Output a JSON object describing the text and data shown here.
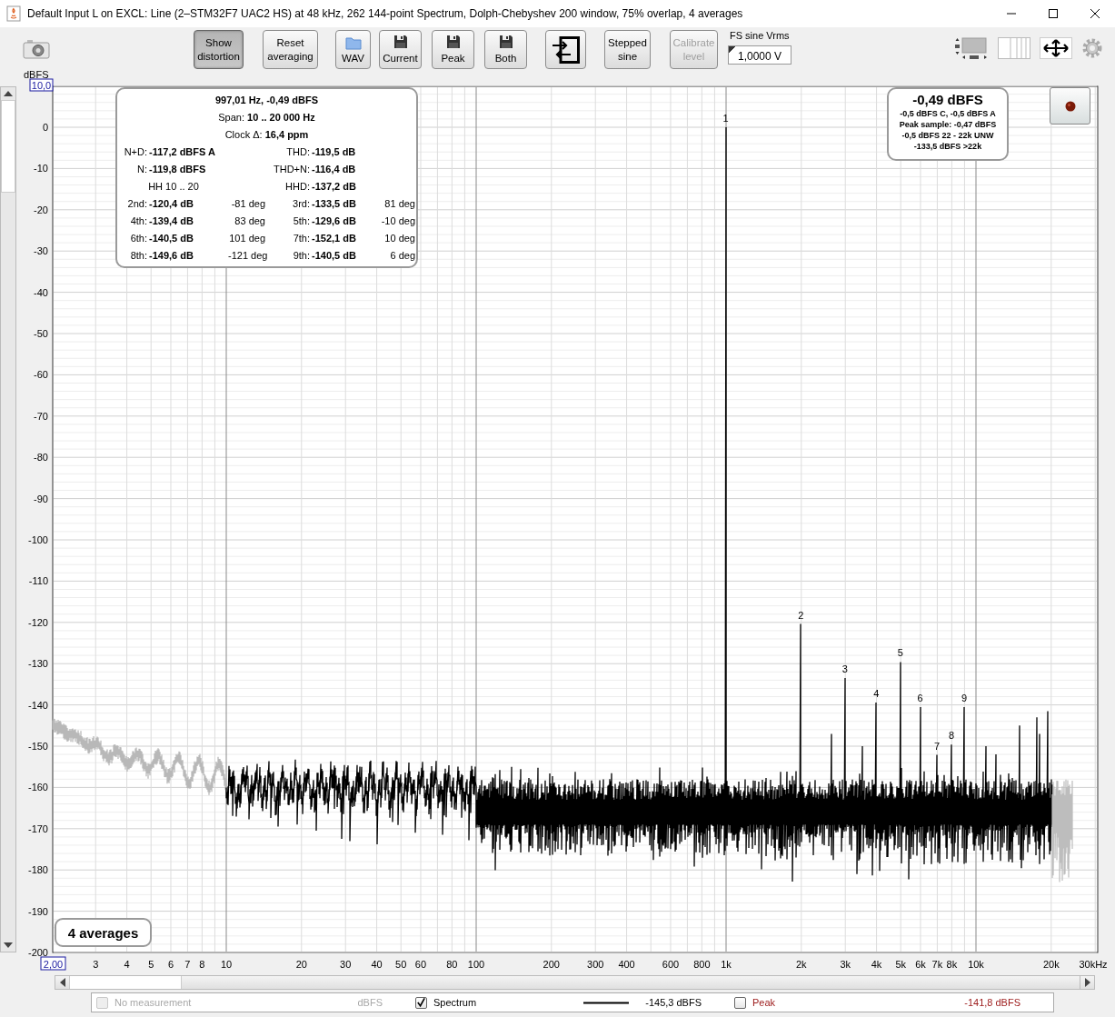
{
  "window": {
    "title": "Default Input L on EXCL: Line (2–STM32F7 UAC2 HS) at 48 kHz, 262 144-point Spectrum, Dolph-Chebyshev 200 window, 75% overlap, 4 averages"
  },
  "toolbar": {
    "buttons": [
      {
        "kind": "text",
        "label": "Show distortion",
        "selected": true,
        "disabled": false
      },
      {
        "kind": "text",
        "label": "Reset averaging",
        "selected": false,
        "disabled": false
      },
      {
        "kind": "folder",
        "label": "WAV",
        "selected": false,
        "disabled": false
      },
      {
        "kind": "save",
        "label": "Current",
        "selected": false,
        "disabled": false
      },
      {
        "kind": "save",
        "label": "Peak",
        "selected": false,
        "disabled": false
      },
      {
        "kind": "save",
        "label": "Both",
        "selected": false,
        "disabled": false
      },
      {
        "kind": "import",
        "selected": false,
        "disabled": false
      },
      {
        "kind": "text",
        "label": "Stepped sine",
        "selected": false,
        "disabled": false
      },
      {
        "kind": "text",
        "label": "Calibrate level",
        "selected": false,
        "disabled": true
      }
    ],
    "fs_field": {
      "label": "FS sine Vrms",
      "value": "1,0000 V"
    }
  },
  "plot": {
    "y_unit": "dBFS",
    "y_max_field": "10,0",
    "x_min_field": "2,00",
    "y_labels": [
      "0",
      "-10",
      "-20",
      "-30",
      "-40",
      "-50",
      "-60",
      "-70",
      "-80",
      "-90",
      "-100",
      "-110",
      "-120",
      "-130",
      "-140",
      "-150",
      "-160",
      "-170",
      "-180",
      "-190",
      "-200"
    ],
    "x_labels": [
      "3",
      "4",
      "5",
      "6",
      "7",
      "8",
      "10",
      "20",
      "30",
      "40",
      "50",
      "60",
      "80",
      "100",
      "200",
      "300",
      "400",
      "600",
      "800",
      "1k",
      "2k",
      "3k",
      "4k",
      "5k",
      "6k",
      "7k",
      "8k",
      "10k",
      "20k",
      "30kHz"
    ],
    "harmonic_markers": [
      "1",
      "2",
      "3",
      "4",
      "5",
      "6",
      "7",
      "8",
      "9"
    ]
  },
  "distortion": {
    "title": "997,01 Hz, -0,49 dBFS",
    "lines": [
      "Span: **10 .. 20 000 Hz**",
      "Clock Δ: **16,4 ppm**"
    ],
    "rows": [
      {
        "left": {
          "label": "N+D:",
          "value": "-117,2 dBFS A"
        },
        "right": {
          "label": "THD:",
          "value": "-119,5 dB"
        }
      },
      {
        "left": {
          "label": "N:",
          "value": "-119,8 dBFS"
        },
        "right": {
          "label": "THD+N:",
          "value": "-116,4 dB"
        }
      },
      {
        "left": {
          "label": "HH 10 .. 20"
        },
        "right": {
          "label": "HHD:",
          "value": "-137,2 dB"
        }
      },
      {
        "left": {
          "label": "2nd:",
          "value": "-120,4 dB",
          "phase": "-81 deg"
        },
        "right": {
          "label": "3rd:",
          "value": "-133,5 dB",
          "phase": "81 deg"
        }
      },
      {
        "left": {
          "label": "4th:",
          "value": "-139,4 dB",
          "phase": "83 deg"
        },
        "right": {
          "label": "5th:",
          "value": "-129,6 dB",
          "phase": "-10 deg"
        }
      },
      {
        "left": {
          "label": "6th:",
          "value": "-140,5 dB",
          "phase": "101 deg"
        },
        "right": {
          "label": "7th:",
          "value": "-152,1 dB",
          "phase": "10 deg"
        }
      },
      {
        "left": {
          "label": "8th:",
          "value": "-149,6 dB",
          "phase": "-121 deg"
        },
        "right": {
          "label": "9th:",
          "value": "-140,5 dB",
          "phase": "6 deg"
        }
      }
    ]
  },
  "level_panel": {
    "main": "-0,49 dBFS",
    "lines": [
      "-0,5 dBFS C, -0,5 dBFS A",
      "Peak sample: -0,47 dBFS",
      "-0,5 dBFS 22 - 22k UNW",
      "-133,5 dBFS >22k"
    ]
  },
  "averages": "4 averages",
  "legend": [
    {
      "kind": "placeholder",
      "label": "No measurement",
      "reading": "dBFS",
      "checked": false,
      "disabled": true,
      "color": "#a8a8a8"
    },
    {
      "kind": "trace",
      "label": "Spectrum",
      "reading": "-145,3 dBFS",
      "checked": true,
      "disabled": false,
      "color": "#000000"
    },
    {
      "kind": "peak",
      "label": "Peak",
      "reading": "-141,8 dBFS",
      "checked": false,
      "disabled": false,
      "color": "#9c1a1a"
    }
  ]
}
